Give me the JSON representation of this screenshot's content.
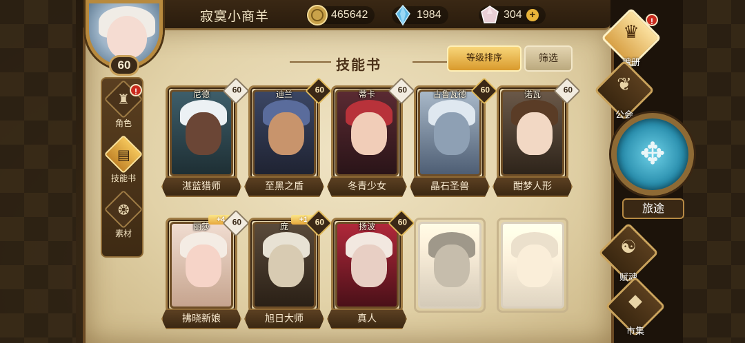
{
  "header": {
    "player_name": "寂寞小商羊",
    "avatar_level": "60",
    "gold": "465642",
    "crystal": "1984",
    "gem": "304",
    "gold_icon": "coin-icon",
    "crystal_icon": "crystal-icon",
    "gem_icon": "gem-icon"
  },
  "left_nav": [
    {
      "label": "角色",
      "icon": "helmet-icon",
      "alert": "!"
    },
    {
      "label": "技能书",
      "icon": "book-icon"
    },
    {
      "label": "素材",
      "icon": "material-icon"
    }
  ],
  "page": {
    "title": "技能书",
    "sort_label": "等级排序",
    "filter_label": "筛选"
  },
  "cards": [
    {
      "hero": "尼德",
      "book": "湛蓝猎师",
      "level": "60"
    },
    {
      "hero": "迪兰",
      "book": "至黑之盾",
      "level": "60"
    },
    {
      "hero": "蒂卡",
      "book": "冬青少女",
      "level": "60"
    },
    {
      "hero": "古鲁瓦德",
      "book": "晶石圣兽",
      "level": "60"
    },
    {
      "hero": "诺瓦",
      "book": "酣梦人形",
      "level": "60"
    },
    {
      "hero": "丽莎",
      "book": "拂晓新娘",
      "level": "60",
      "plus": "+4"
    },
    {
      "hero": "庞",
      "book": "旭日大师",
      "level": "60",
      "plus": "+1"
    },
    {
      "hero": "扬波",
      "book": "真人",
      "level": "60"
    }
  ],
  "right_nav": [
    {
      "label": "魂册",
      "alert": "!"
    },
    {
      "label": "公会"
    },
    {
      "label": "旅途"
    },
    {
      "label": "赋魂"
    },
    {
      "label": "市集"
    }
  ],
  "colors": {
    "parchment": "#e8dab5",
    "gold_accent": "#e0b95a",
    "dark_brown": "#3a2816"
  }
}
